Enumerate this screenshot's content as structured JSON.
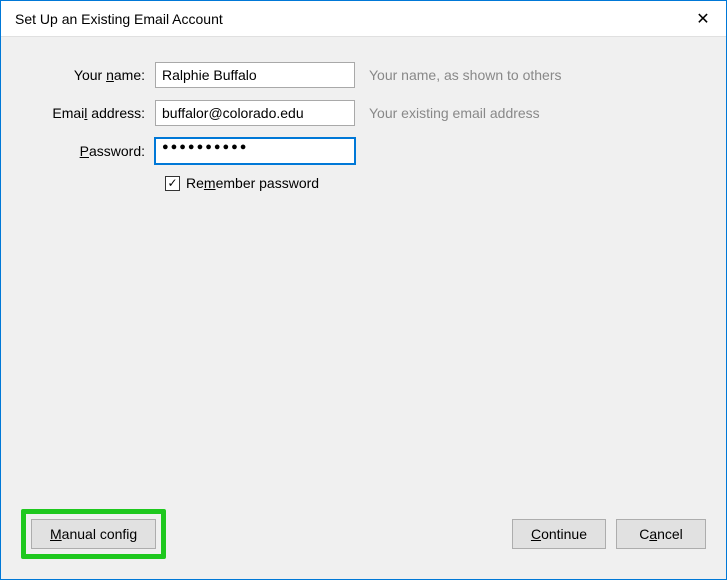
{
  "window": {
    "title": "Set Up an Existing Email Account",
    "close_glyph": "✕"
  },
  "form": {
    "name": {
      "label_pre": "Your ",
      "label_u": "n",
      "label_post": "ame:",
      "value": "Ralphie Buffalo",
      "hint": "Your name, as shown to others"
    },
    "email": {
      "label_pre": "Emai",
      "label_u": "l",
      "label_post": " address:",
      "value": "buffalor@colorado.edu",
      "hint": "Your existing email address"
    },
    "password": {
      "label_pre": "",
      "label_u": "P",
      "label_post": "assword:",
      "value_masked": "●●●●●●●●●●",
      "hint": ""
    },
    "remember": {
      "checked_glyph": "✓",
      "label_pre": "Re",
      "label_u": "m",
      "label_post": "ember password"
    }
  },
  "buttons": {
    "manual_pre": "",
    "manual_u": "M",
    "manual_post": "anual config",
    "continue_pre": "",
    "continue_u": "C",
    "continue_post": "ontinue",
    "cancel_pre": "C",
    "cancel_u": "a",
    "cancel_post": "ncel"
  }
}
